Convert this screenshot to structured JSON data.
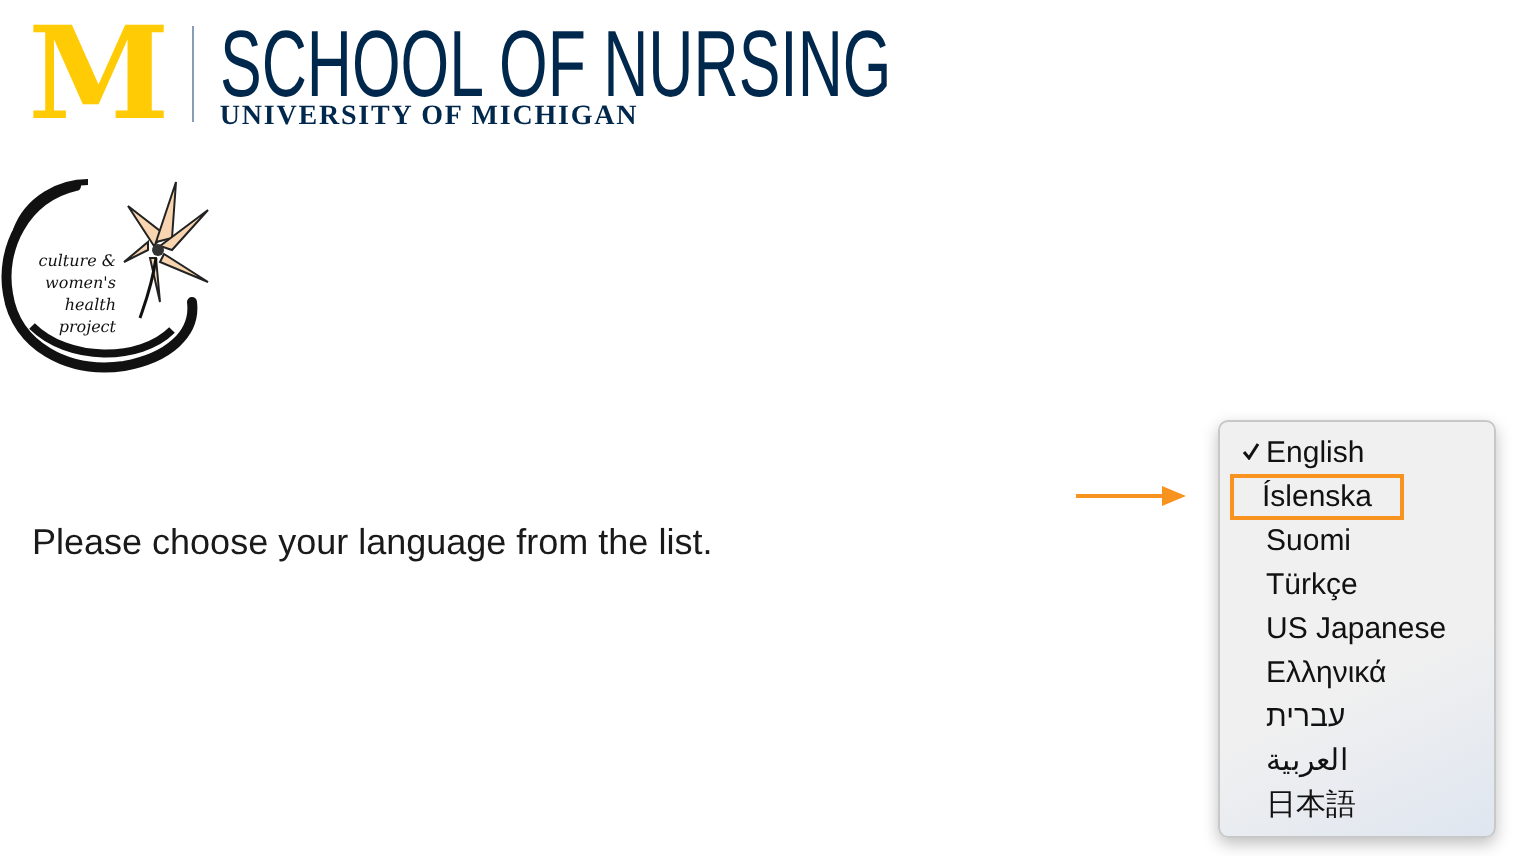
{
  "header": {
    "logo_mark": "M",
    "title": "SCHOOL OF NURSING",
    "subtitle": "UNIVERSITY OF MICHIGAN"
  },
  "project_logo": {
    "lines": [
      "culture &",
      "women's",
      "health",
      "project"
    ]
  },
  "prompt": "Please choose your language from the list.",
  "language_menu": {
    "items": [
      {
        "label": "English",
        "checked": true,
        "highlighted": false
      },
      {
        "label": "Íslenska",
        "checked": false,
        "highlighted": true
      },
      {
        "label": "Suomi",
        "checked": false,
        "highlighted": false
      },
      {
        "label": "Türkçe",
        "checked": false,
        "highlighted": false
      },
      {
        "label": "US Japanese",
        "checked": false,
        "highlighted": false
      },
      {
        "label": "Ελληνικά",
        "checked": false,
        "highlighted": false
      },
      {
        "label": "עברית",
        "checked": false,
        "highlighted": false
      },
      {
        "label": "العربية",
        "checked": false,
        "highlighted": false
      },
      {
        "label": "日本語",
        "checked": false,
        "highlighted": false
      }
    ]
  }
}
